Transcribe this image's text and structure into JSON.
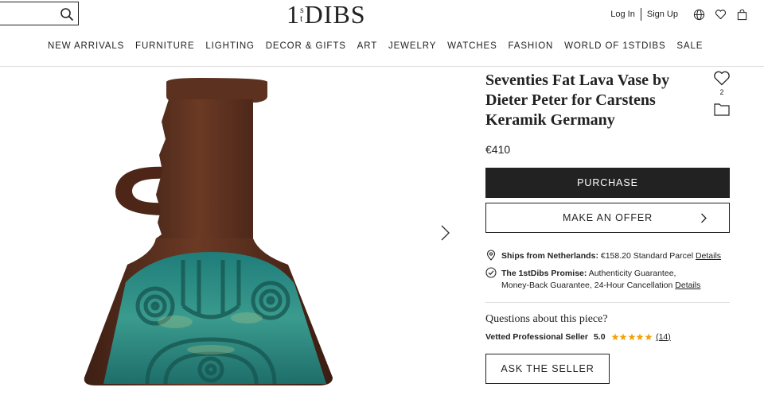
{
  "header": {
    "search": {
      "value": "",
      "placeholder": ""
    },
    "logo": {
      "one": "1",
      "s": "s",
      "t": "t",
      "dibs": "DIBS"
    },
    "login": "Log In",
    "signup": "Sign Up"
  },
  "nav": {
    "items": [
      "NEW ARRIVALS",
      "FURNITURE",
      "LIGHTING",
      "DECOR & GIFTS",
      "ART",
      "JEWELRY",
      "WATCHES",
      "FASHION",
      "WORLD OF 1STDIBS",
      "SALE"
    ]
  },
  "product": {
    "title": "Seventies Fat Lava Vase by Dieter Peter for Carstens Keramik Germany",
    "favorites_count": "2",
    "price": "€410",
    "purchase_label": "PURCHASE",
    "offer_label": "MAKE AN OFFER",
    "shipping": {
      "label": "Ships from Netherlands:",
      "detail": " €158.20 Standard Parcel ",
      "link": "Details"
    },
    "promise": {
      "label": "The 1stDibs Promise:",
      "line1": " Authenticity Guarantee,",
      "line2": "Money-Back Guarantee, 24-Hour Cancellation ",
      "link": "Details"
    },
    "questions_heading": "Questions about this piece?",
    "seller": {
      "label": "Vetted Professional Seller",
      "rating": "5.0",
      "stars": 5,
      "review_count": "(14)"
    },
    "ask_label": "ASK THE SELLER"
  },
  "colors": {
    "accent": "#222222",
    "star": "#f0a30a",
    "vase_brown": "#5a2f1f",
    "vase_teal": "#2c8a86"
  }
}
